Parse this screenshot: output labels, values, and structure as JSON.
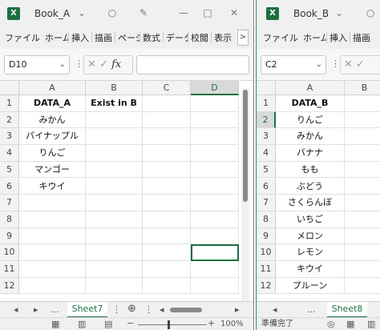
{
  "book_a": {
    "title": "Book_A",
    "excel_icon": "X",
    "ribbon_tabs": [
      "ファイル",
      "ホーム",
      "挿入",
      "描画",
      "ページ",
      "数式",
      "データ",
      "校閲",
      "表示"
    ],
    "ribbon_more": ">",
    "name_box": "D10",
    "fx": "fx",
    "columns": [
      "A",
      "B",
      "C",
      "D"
    ],
    "rows": [
      "1",
      "2",
      "3",
      "4",
      "5",
      "6",
      "7",
      "8",
      "9",
      "10",
      "11",
      "12"
    ],
    "cells": [
      [
        "DATA_A",
        "Exist in B",
        "",
        ""
      ],
      [
        "みかん",
        "",
        "",
        ""
      ],
      [
        "パイナップル",
        "",
        "",
        ""
      ],
      [
        "りんご",
        "",
        "",
        ""
      ],
      [
        "マンゴー",
        "",
        "",
        ""
      ],
      [
        "キウイ",
        "",
        "",
        ""
      ],
      [
        "",
        "",
        "",
        ""
      ],
      [
        "",
        "",
        "",
        ""
      ],
      [
        "",
        "",
        "",
        ""
      ],
      [
        "",
        "",
        "",
        ""
      ],
      [
        "",
        "",
        "",
        ""
      ],
      [
        "",
        "",
        "",
        ""
      ]
    ],
    "sheet_tab": "Sheet7",
    "tab_nav": [
      "◂",
      "▸",
      "..."
    ],
    "zoom": "100%"
  },
  "book_b": {
    "title": "Book_B",
    "excel_icon": "X",
    "ribbon_tabs": [
      "ファイル",
      "ホーム",
      "挿入",
      "描画"
    ],
    "name_box": "C2",
    "columns": [
      "A",
      "B"
    ],
    "rows": [
      "1",
      "2",
      "3",
      "4",
      "5",
      "6",
      "7",
      "8",
      "9",
      "10",
      "11",
      "12"
    ],
    "cells": [
      [
        "DATA_B"
      ],
      [
        "りんご"
      ],
      [
        "みかん"
      ],
      [
        "バナナ"
      ],
      [
        "もも"
      ],
      [
        "ぶどう"
      ],
      [
        "さくらんぼ"
      ],
      [
        "いちご"
      ],
      [
        "メロン"
      ],
      [
        "レモン"
      ],
      [
        "キウイ"
      ],
      [
        "プルーン"
      ]
    ],
    "sheet_tab": "Sheet8",
    "tab_nav": [
      "◂",
      "..."
    ],
    "status": "準備完了"
  },
  "colors": {
    "excel_green": "#1d6f42",
    "accent": "#1e7145"
  }
}
